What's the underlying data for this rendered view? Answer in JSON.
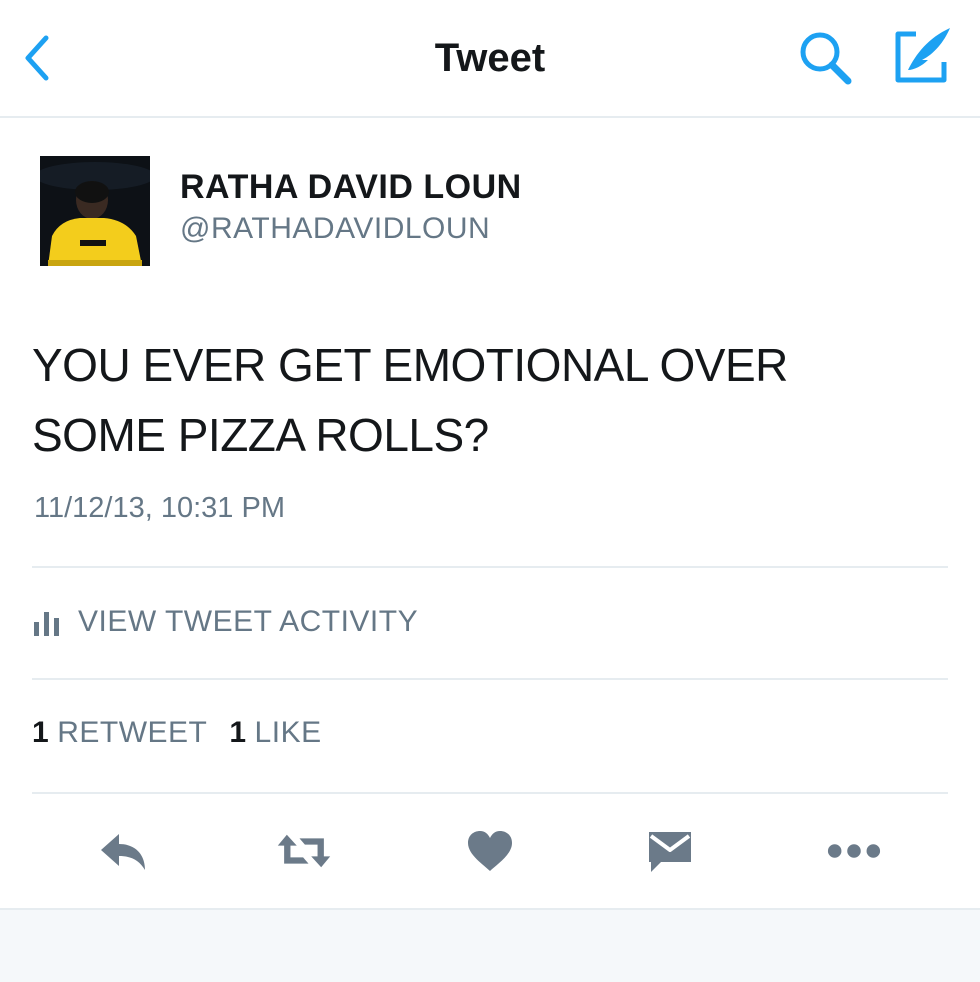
{
  "nav": {
    "title": "Tweet",
    "back_icon": "chevron-left-icon",
    "search_icon": "search-icon",
    "compose_icon": "compose-icon"
  },
  "tweet": {
    "author_name": "RATHA DAVID LOUN",
    "author_handle": "@RATHADAVIDLOUN",
    "text_line1": "YOU EVER GET EMOTIONAL OVER",
    "text_line2": "SOME PIZZA ROLLS?",
    "timestamp": "11/12/13, 10:31 PM"
  },
  "activity": {
    "label": "VIEW TWEET ACTIVITY",
    "icon": "bar-chart-icon"
  },
  "stats": {
    "retweets_count": "1",
    "retweets_label": "RETWEET",
    "likes_count": "1",
    "likes_label": "LIKE"
  },
  "actions": [
    "reply-icon",
    "retweet-icon",
    "heart-icon",
    "message-icon",
    "more-icon"
  ],
  "colors": {
    "accent": "#1da1f2",
    "text": "#14171a",
    "secondary": "#657786",
    "action_icon": "#6b7a89",
    "divider": "#e6ecf0"
  }
}
